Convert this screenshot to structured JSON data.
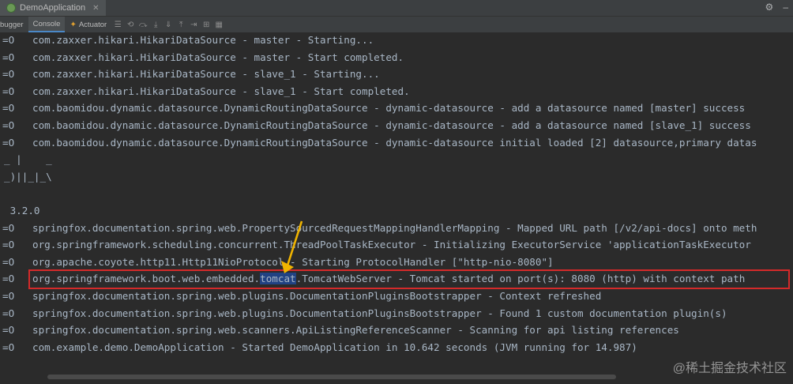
{
  "window": {
    "app_tab": "DemoApplication"
  },
  "toolbar": {
    "debugger_label": "bugger",
    "console_label": "Console",
    "actuator_label": "Actuator"
  },
  "console": {
    "lines": [
      {
        "level": "=O",
        "text": "com.zaxxer.hikari.HikariDataSource - master - Starting..."
      },
      {
        "level": "=O",
        "text": "com.zaxxer.hikari.HikariDataSource - master - Start completed."
      },
      {
        "level": "=O",
        "text": "com.zaxxer.hikari.HikariDataSource - slave_1 - Starting..."
      },
      {
        "level": "=O",
        "text": "com.zaxxer.hikari.HikariDataSource - slave_1 - Start completed."
      },
      {
        "level": "=O",
        "text": "com.baomidou.dynamic.datasource.DynamicRoutingDataSource - dynamic-datasource - add a datasource named [master] success"
      },
      {
        "level": "=O",
        "text": "com.baomidou.dynamic.datasource.DynamicRoutingDataSource - dynamic-datasource - add a datasource named [slave_1] success"
      },
      {
        "level": "=O",
        "text": "com.baomidou.dynamic.datasource.DynamicRoutingDataSource - dynamic-datasource initial loaded [2] datasource,primary datas"
      },
      {
        "banner": "_ |    _"
      },
      {
        "banner": "_)||_|_\\"
      },
      {
        "banner": ""
      },
      {
        "banner": " 3.2.0"
      },
      {
        "level": "=O",
        "text": "springfox.documentation.spring.web.PropertySourcedRequestMappingHandlerMapping - Mapped URL path [/v2/api-docs] onto meth"
      },
      {
        "level": "=O",
        "text": "org.springframework.scheduling.concurrent.ThreadPoolTaskExecutor - Initializing ExecutorService 'applicationTaskExecutor"
      },
      {
        "level": "=O",
        "text": "org.apache.coyote.http11.Http11NioProtocol - Starting ProtocolHandler [\"http-nio-8080\"]"
      },
      {
        "level": "=O",
        "pre": "org.springframework.boot.web.embedded.",
        "highlight": "tomcat",
        "post": ".TomcatWebServer - Tomcat started on port(s): 8080 (http) with context path"
      },
      {
        "level": "=O",
        "text": "springfox.documentation.spring.web.plugins.DocumentationPluginsBootstrapper - Context refreshed"
      },
      {
        "level": "=O",
        "text": "springfox.documentation.spring.web.plugins.DocumentationPluginsBootstrapper - Found 1 custom documentation plugin(s)"
      },
      {
        "level": "=O",
        "text": "springfox.documentation.spring.web.scanners.ApiListingReferenceScanner - Scanning for api listing references"
      },
      {
        "level": "=O",
        "text": "com.example.demo.DemoApplication - Started DemoApplication in 10.642 seconds (JVM running for 14.987)"
      }
    ]
  },
  "watermark": "@稀土掘金技术社区",
  "icons": {
    "settings": "gear-icon",
    "minimize": "minimize-icon",
    "actuator": "actuator-icon",
    "menu": "menu-icon",
    "toolbar_tools": [
      "restore-layout-icon",
      "step-over-icon",
      "step-into-icon",
      "force-step-into-icon",
      "step-out-icon",
      "run-to-cursor-icon",
      "evaluate-icon",
      "table-view-icon"
    ]
  }
}
